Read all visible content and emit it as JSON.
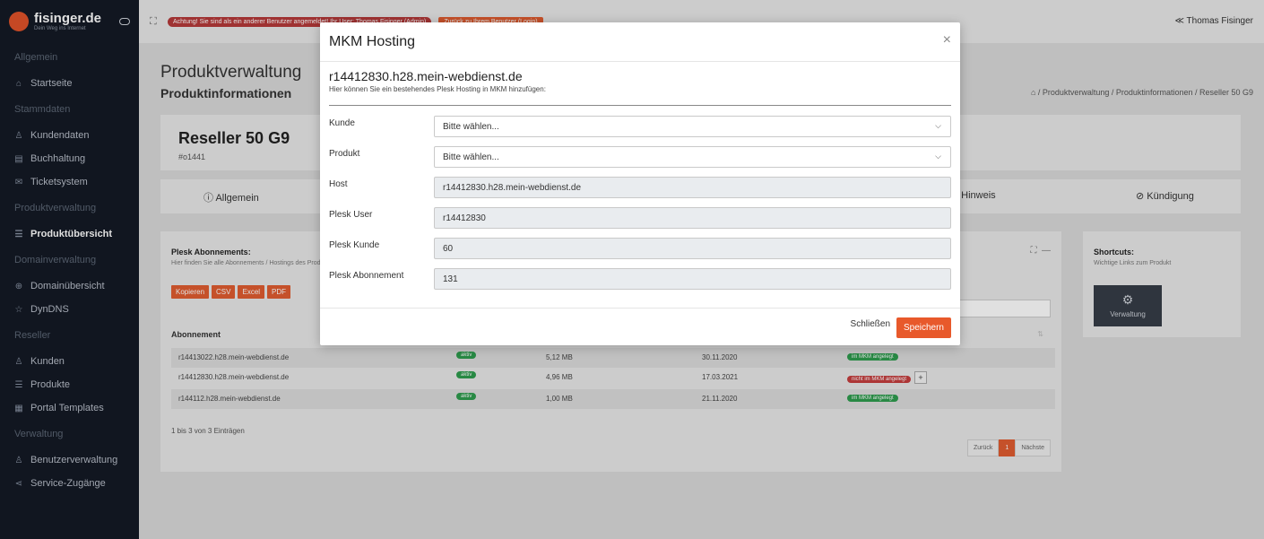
{
  "brand": {
    "name": "fisinger.de",
    "tagline": "Dein Weg ins Internet"
  },
  "sidebar": {
    "groups": [
      {
        "section": "Allgemein",
        "items": [
          {
            "label": "Startseite",
            "icon": "home-icon"
          }
        ]
      },
      {
        "section": "Stammdaten",
        "items": [
          {
            "label": "Kundendaten",
            "icon": "user-icon"
          },
          {
            "label": "Buchhaltung",
            "icon": "document-icon"
          },
          {
            "label": "Ticketsystem",
            "icon": "mail-icon"
          }
        ]
      },
      {
        "section": "Produktverwaltung",
        "items": [
          {
            "label": "Produktübersicht",
            "icon": "list-icon",
            "active": true
          }
        ]
      },
      {
        "section": "Domainverwaltung",
        "items": [
          {
            "label": "Domainübersicht",
            "icon": "globe-icon"
          },
          {
            "label": "DynDNS",
            "icon": "star-icon"
          }
        ]
      },
      {
        "section": "Reseller",
        "items": [
          {
            "label": "Kunden",
            "icon": "user-icon"
          },
          {
            "label": "Produkte",
            "icon": "list-icon"
          },
          {
            "label": "Portal Templates",
            "icon": "template-icon"
          }
        ]
      },
      {
        "section": "Verwaltung",
        "items": [
          {
            "label": "Benutzerverwaltung",
            "icon": "users-icon"
          },
          {
            "label": "Service-Zugänge",
            "icon": "share-icon"
          }
        ]
      }
    ]
  },
  "topbar": {
    "warning": "Achtung! Sie sind als ein anderer Benutzer angemeldet! Ihr User: Thomas Fisinger (Admin)",
    "back_button": "Zurück zu Ihrem Benutzer (Login)",
    "user": "Thomas Fisinger"
  },
  "page": {
    "title": "Produktverwaltung",
    "subtitle": "Produktinformationen",
    "breadcrumb": "/ Produktverwaltung / Produktinformationen / Reseller 50 G9"
  },
  "product": {
    "name": "Reseller 50 G9",
    "id": "#o1441"
  },
  "tabs": {
    "allgemein": "Allgemein",
    "hinweis": "Hinweis",
    "kuendigung": "Kündigung"
  },
  "plesk": {
    "title": "Plesk Abonnements:",
    "description": "Hier finden Sie alle Abonnements / Hostings des Produkts",
    "export_buttons": [
      "Kopieren",
      "CSV",
      "Excel",
      "PDF"
    ],
    "column_subscription": "Abonnement",
    "rows": [
      {
        "name": "r14413022.h28.mein-webdienst.de",
        "status": "aktiv",
        "size": "5,12 MB",
        "date": "30.11.2020",
        "mkm": "im MKM angelegt",
        "mkm_ok": true
      },
      {
        "name": "r14412830.h28.mein-webdienst.de",
        "status": "aktiv",
        "size": "4,96 MB",
        "date": "17.03.2021",
        "mkm": "nicht im MKM angelegt",
        "mkm_ok": false
      },
      {
        "name": "r144112.h28.mein-webdienst.de",
        "status": "aktiv",
        "size": "1,00 MB",
        "date": "21.11.2020",
        "mkm": "im MKM angelegt",
        "mkm_ok": true
      }
    ],
    "add_symbol": "+",
    "entries_info": "1 bis 3 von 3 Einträgen",
    "pagination": {
      "prev": "Zurück",
      "current": "1",
      "next": "Nächste"
    }
  },
  "shortcuts": {
    "title": "Shortcuts:",
    "description": "Wichtige Links zum Produkt",
    "button": "Verwaltung"
  },
  "modal": {
    "title": "MKM Hosting",
    "close_symbol": "×",
    "host_heading": "r14412830.h28.mein-webdienst.de",
    "hint": "Hier können Sie ein bestehendes Plesk Hosting in MKM hinzufügen:",
    "fields": [
      {
        "label": "Kunde",
        "value": "Bitte wählen...",
        "type": "select"
      },
      {
        "label": "Produkt",
        "value": "Bitte wählen...",
        "type": "select"
      },
      {
        "label": "Host",
        "value": "r14412830.h28.mein-webdienst.de",
        "type": "readonly"
      },
      {
        "label": "Plesk User",
        "value": "r14412830",
        "type": "readonly"
      },
      {
        "label": "Plesk Kunde",
        "value": "60",
        "type": "readonly"
      },
      {
        "label": "Plesk Abonnement",
        "value": "131",
        "type": "readonly"
      }
    ],
    "close_button": "Schließen",
    "save_button": "Speichern"
  },
  "colors": {
    "accent": "#e8592b",
    "sidebar": "#141a25",
    "success": "#2e9c4e",
    "danger": "#c53e3e"
  }
}
